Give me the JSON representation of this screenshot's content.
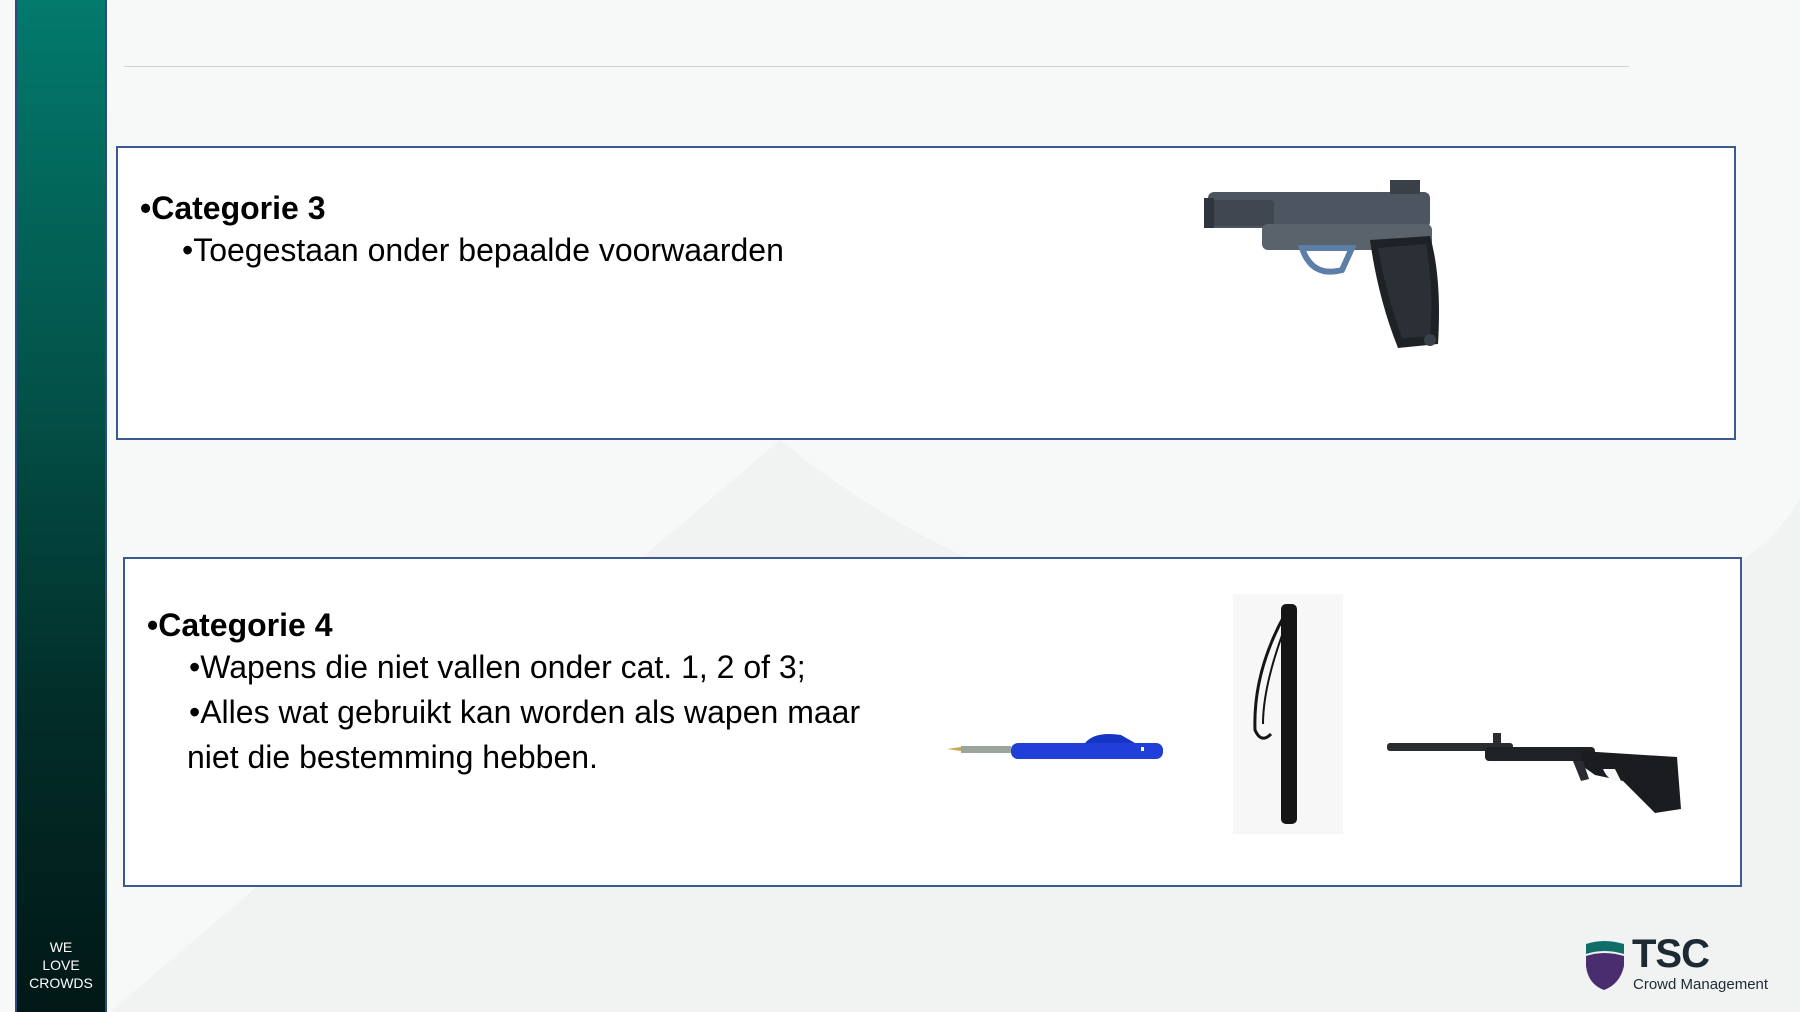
{
  "sidebar": {
    "tagline": [
      "WE",
      "LOVE",
      "CROWDS"
    ]
  },
  "category3": {
    "heading": "Categorie 3",
    "bullets": [
      "Toegestaan onder bepaalde voorwaarden"
    ],
    "image": "pistol-image"
  },
  "category4": {
    "heading": "Categorie 4",
    "bullets": [
      [
        "Wapens die niet vallen onder cat. 1, 2 of 3;"
      ],
      [
        "Alles wat gebruikt kan worden als wapen maar",
        "niet die bestemming hebben."
      ]
    ],
    "images": [
      "pen-image",
      "baton-image",
      "air-rifle-image"
    ]
  },
  "logo": {
    "title": "TSC",
    "subtitle": "Crowd Management",
    "colors": {
      "teal": "#0f6e68",
      "purple": "#4a2d6e"
    }
  },
  "colors": {
    "sidebar_top": "#027a6c",
    "sidebar_bottom": "#011816",
    "box_border": "#3c5a92"
  }
}
